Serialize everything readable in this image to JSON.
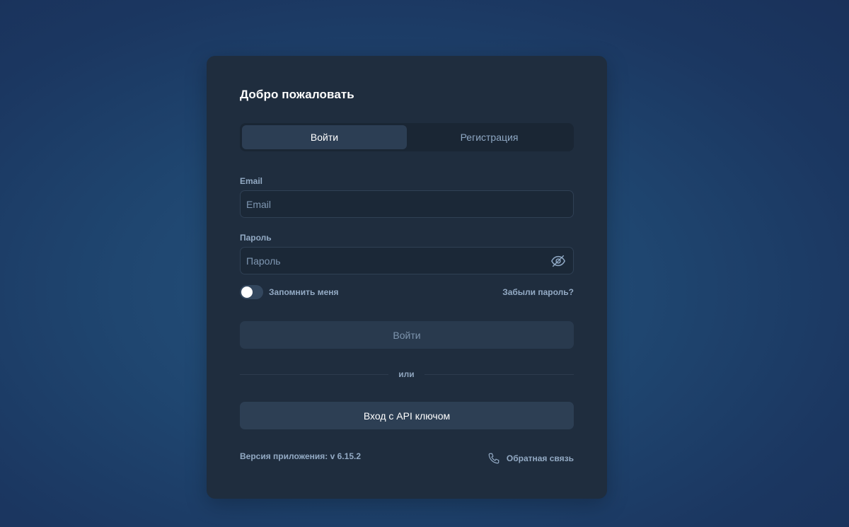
{
  "title": "Добро пожаловать",
  "tabs": [
    {
      "label": "Войти",
      "active": true
    },
    {
      "label": "Регистрация",
      "active": false
    }
  ],
  "email": {
    "label": "Email",
    "placeholder": "Email",
    "value": ""
  },
  "password": {
    "label": "Пароль",
    "placeholder": "Пароль",
    "value": "",
    "visibility_icon": "eye-off-icon"
  },
  "remember": {
    "label": "Запомнить меня",
    "checked": false
  },
  "forgot_label": "Забыли пароль?",
  "login_button": "Войти",
  "divider_text": "или",
  "api_button": "Вход с API ключом",
  "version": "Версия приложения: v 6.15.2",
  "feedback": {
    "label": "Обратная связь",
    "icon": "phone-icon"
  },
  "colors": {
    "card": "#1f2d3e",
    "accent_text": "#93aac4",
    "tab_active": "#2c3e54"
  }
}
